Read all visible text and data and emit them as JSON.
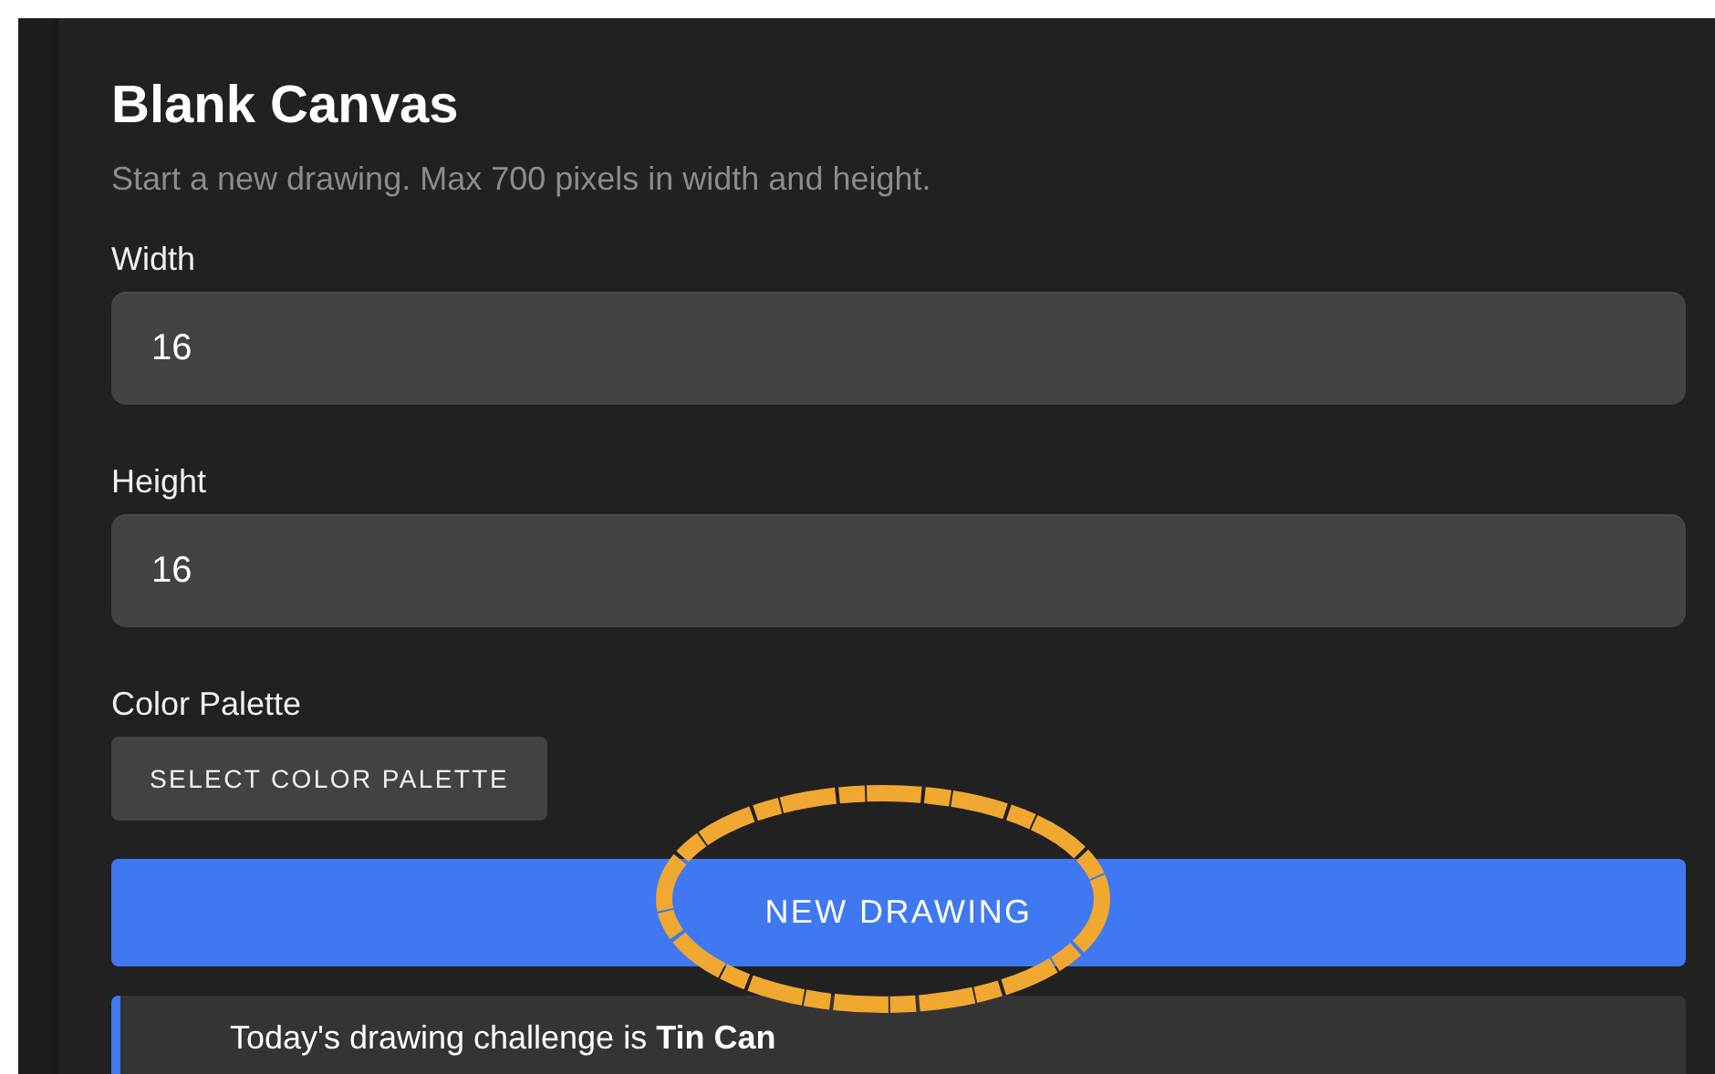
{
  "title": "Blank Canvas",
  "subtitle": "Start a new drawing. Max 700 pixels in width and height.",
  "fields": [
    {
      "label": "Width",
      "value": "16"
    },
    {
      "label": "Height",
      "value": "16"
    }
  ],
  "palette": {
    "label": "Color Palette",
    "button": "SELECT COLOR PALETTE"
  },
  "primary_button": "NEW DRAWING",
  "challenge": {
    "text": "Today's drawing challenge is **Tin Can**"
  }
}
